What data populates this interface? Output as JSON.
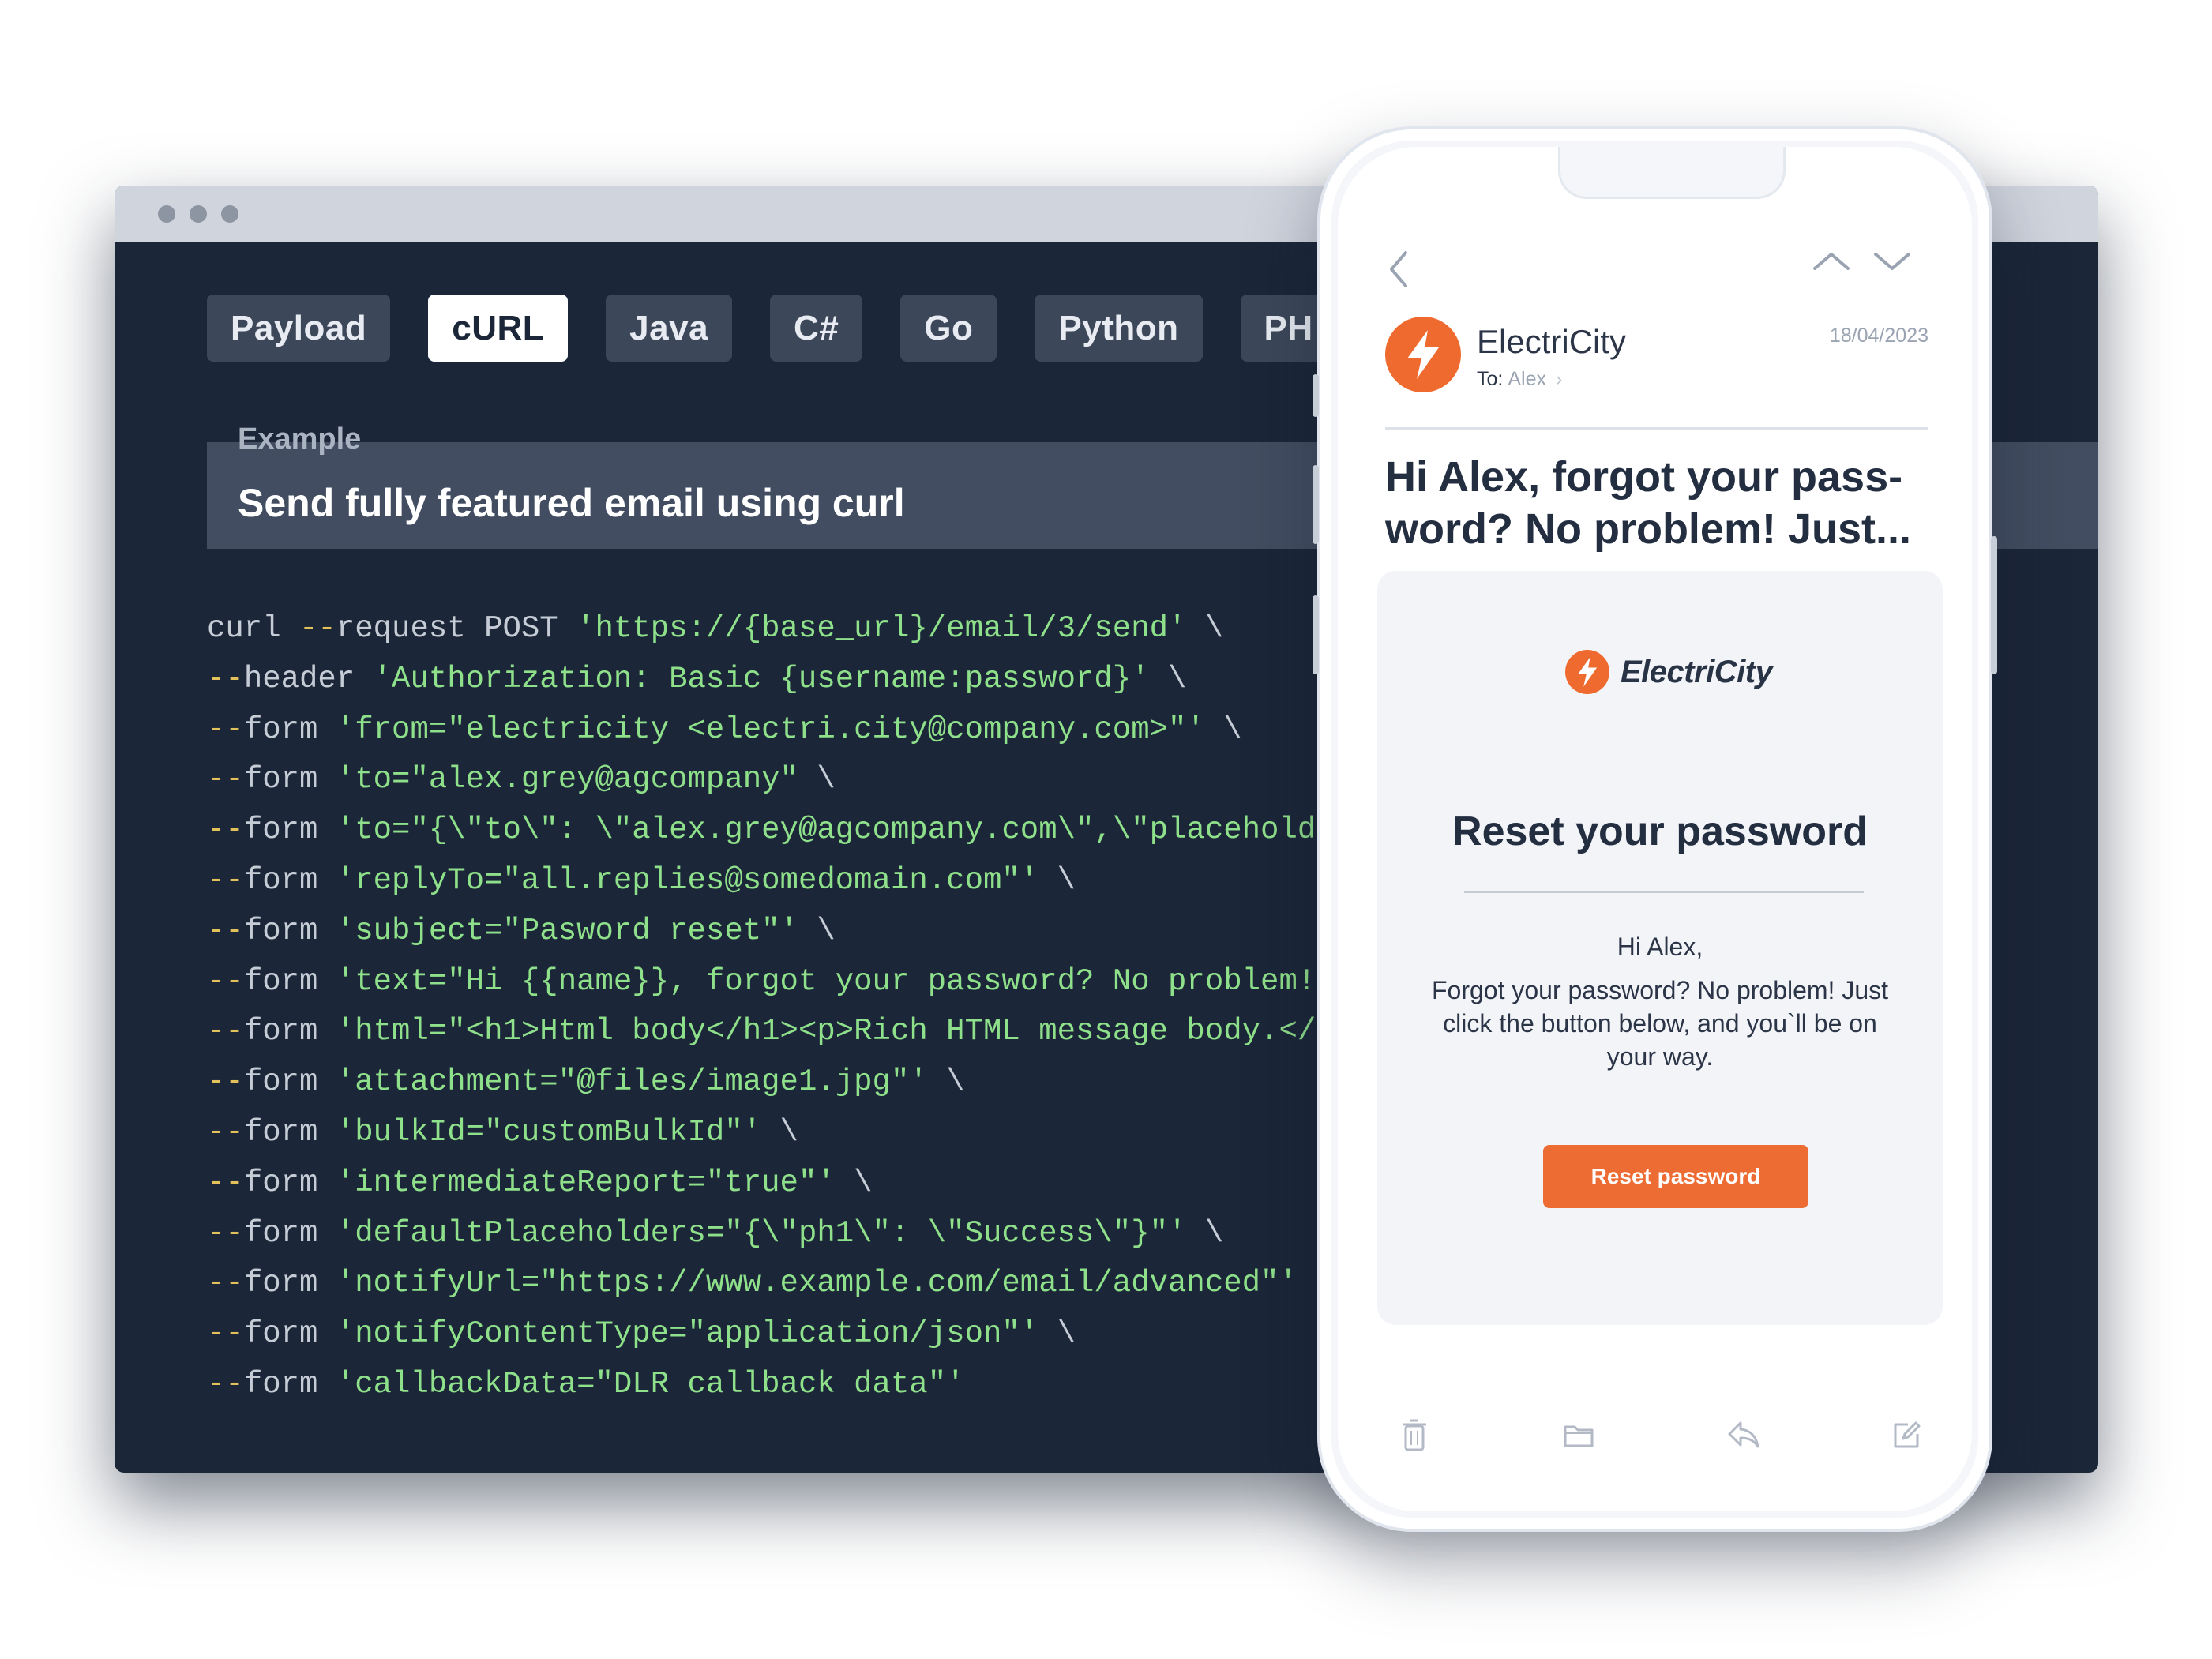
{
  "editor": {
    "tabs": [
      "Payload",
      "cURL",
      "Java",
      "C#",
      "Go",
      "Python",
      "PH"
    ],
    "active_tab": "cURL",
    "example_label": "Example",
    "example_title": "Send fully featured email using curl",
    "code_lines": [
      [
        {
          "t": "curl ",
          "c": "kw"
        },
        {
          "t": "--",
          "c": "fl"
        },
        {
          "t": "request POST ",
          "c": "kw"
        },
        {
          "t": "'https://{base_url}/email/3/send'",
          "c": "st"
        },
        {
          "t": " \\",
          "c": "kw"
        }
      ],
      [
        {
          "t": "--",
          "c": "fl"
        },
        {
          "t": "header ",
          "c": "kw"
        },
        {
          "t": "'Authorization: Basic {username:password}'",
          "c": "st"
        },
        {
          "t": " \\",
          "c": "kw"
        }
      ],
      [
        {
          "t": "--",
          "c": "fl"
        },
        {
          "t": "form ",
          "c": "kw"
        },
        {
          "t": "'from=\"electricity <electri.city@company.com>\"'",
          "c": "st"
        },
        {
          "t": " \\",
          "c": "kw"
        }
      ],
      [
        {
          "t": "--",
          "c": "fl"
        },
        {
          "t": "form ",
          "c": "kw"
        },
        {
          "t": "'to=\"alex.grey@agcompany\"",
          "c": "st"
        },
        {
          "t": " \\",
          "c": "kw"
        }
      ],
      [
        {
          "t": "--",
          "c": "fl"
        },
        {
          "t": "form ",
          "c": "kw"
        },
        {
          "t": "'to=\"{\\\"to\\\": \\\"alex.grey@agcompany.com\\\",\\\"placeholders\\",
          "c": "st"
        }
      ],
      [
        {
          "t": "--",
          "c": "fl"
        },
        {
          "t": "form ",
          "c": "kw"
        },
        {
          "t": "'replyTo=\"all.replies@somedomain.com\"'",
          "c": "st"
        },
        {
          "t": " \\",
          "c": "kw"
        }
      ],
      [
        {
          "t": "--",
          "c": "fl"
        },
        {
          "t": "form ",
          "c": "kw"
        },
        {
          "t": "'subject=\"Pasword reset\"'",
          "c": "st"
        },
        {
          "t": " \\",
          "c": "kw"
        }
      ],
      [
        {
          "t": "--",
          "c": "fl"
        },
        {
          "t": "form ",
          "c": "kw"
        },
        {
          "t": "'text=\"Hi {{name}}, forgot your password? No problem!",
          "c": "st"
        }
      ],
      [
        {
          "t": "--",
          "c": "fl"
        },
        {
          "t": "form ",
          "c": "kw"
        },
        {
          "t": "'html=\"<h1>Html body</h1><p>Rich HTML message body.</p",
          "c": "st"
        }
      ],
      [
        {
          "t": "--",
          "c": "fl"
        },
        {
          "t": "form ",
          "c": "kw"
        },
        {
          "t": "'attachment=\"@files/image1.jpg\"'",
          "c": "st"
        },
        {
          "t": " \\",
          "c": "kw"
        }
      ],
      [
        {
          "t": "--",
          "c": "fl"
        },
        {
          "t": "form ",
          "c": "kw"
        },
        {
          "t": "'bulkId=\"customBulkId\"'",
          "c": "st"
        },
        {
          "t": " \\",
          "c": "kw"
        }
      ],
      [
        {
          "t": "--",
          "c": "fl"
        },
        {
          "t": "form ",
          "c": "kw"
        },
        {
          "t": "'intermediateReport=\"true\"'",
          "c": "st"
        },
        {
          "t": " \\",
          "c": "kw"
        }
      ],
      [
        {
          "t": "--",
          "c": "fl"
        },
        {
          "t": "form ",
          "c": "kw"
        },
        {
          "t": "'defaultPlaceholders=\"{\\\"ph1\\\": \\\"Success\\\"}\"'",
          "c": "st"
        },
        {
          "t": " \\",
          "c": "kw"
        }
      ],
      [
        {
          "t": "--",
          "c": "fl"
        },
        {
          "t": "form ",
          "c": "kw"
        },
        {
          "t": "'notifyUrl=\"https://www.example.com/email/advanced\"'",
          "c": "st"
        },
        {
          "t": " \\",
          "c": "kw"
        }
      ],
      [
        {
          "t": "--",
          "c": "fl"
        },
        {
          "t": "form ",
          "c": "kw"
        },
        {
          "t": "'notifyContentType=\"application/json\"'",
          "c": "st"
        },
        {
          "t": " \\",
          "c": "kw"
        }
      ],
      [
        {
          "t": "--",
          "c": "fl"
        },
        {
          "t": "form ",
          "c": "kw"
        },
        {
          "t": "'callbackData=\"DLR callback data\"'",
          "c": "st"
        }
      ]
    ]
  },
  "phone": {
    "sender": "ElectriCity",
    "to_label": "To:",
    "to_name": "Alex",
    "date": "18/04/2023",
    "subject": "Hi Alex, forgot your pass-word? No problem! Just...",
    "card": {
      "brand": "ElectriCity",
      "heading": "Reset your password",
      "greeting": "Hi Alex,",
      "body": "Forgot your password? No problem! Just click the button below, and you`ll be on your way.",
      "button": "Reset password"
    },
    "icons": [
      "back-icon",
      "up-icon",
      "down-icon",
      "trash-icon",
      "folder-icon",
      "reply-icon",
      "compose-icon"
    ]
  },
  "colors": {
    "editor_bg": "#1b2638",
    "brand_orange": "#ef6a2f",
    "code_string": "#8fe08a",
    "code_flag": "#e3c15a"
  }
}
